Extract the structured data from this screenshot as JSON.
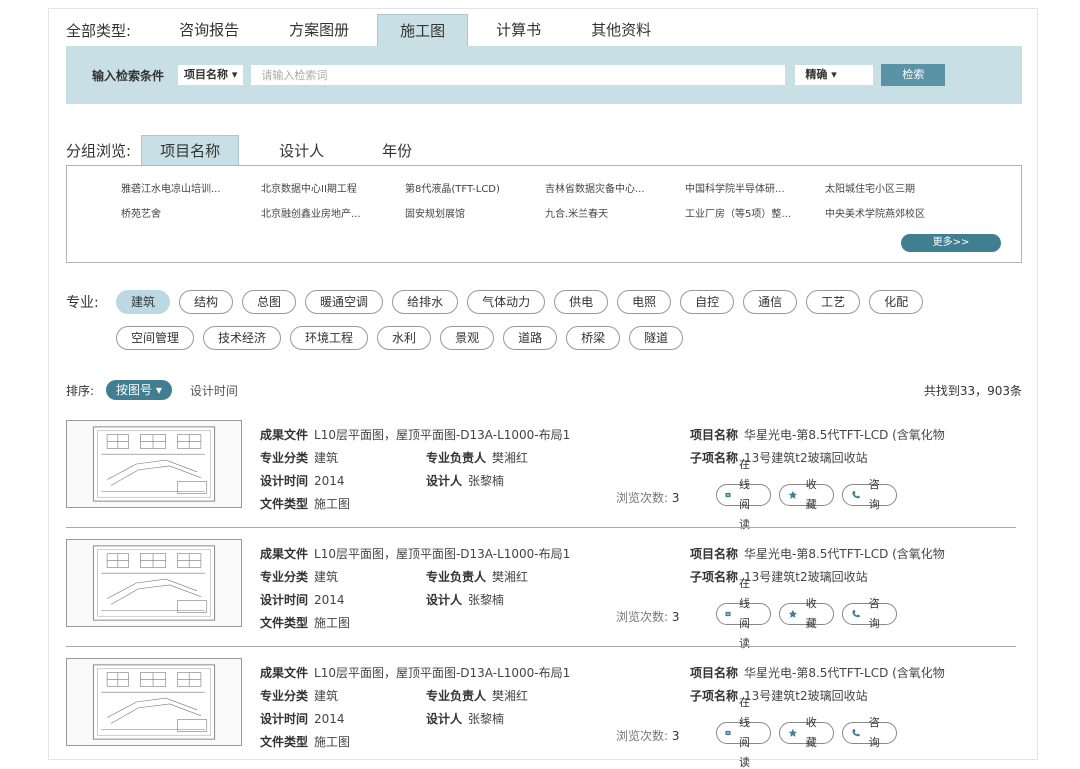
{
  "types": {
    "label": "全部类型:",
    "tabs": [
      "咨询报告",
      "方案图册",
      "施工图",
      "计算书",
      "其他资料"
    ],
    "active": 2
  },
  "search": {
    "label": "输入检索条件",
    "field": "项目名称 ▾",
    "placeholder": "请输入检索词",
    "mode": "精确 ▾",
    "button": "检索"
  },
  "group": {
    "label": "分组浏览:",
    "tabs": [
      "项目名称",
      "设计人",
      "年份"
    ],
    "items": [
      "雅砻江水电凉山培训...",
      "北京数据中心II期工程",
      "第8代液晶(TFT-LCD)",
      "吉林省数据灾备中心...",
      "中国科学院半导体研...",
      "太阳城住宅小区三期",
      "桥苑艺舍",
      "北京融创鑫业房地产...",
      "固安规划展馆",
      "九合.米兰春天",
      "工业厂房（等5项）整...",
      "中央美术学院燕郊校区"
    ],
    "more": "更多>>"
  },
  "specialty": {
    "label": "专业:",
    "row1": [
      "建筑",
      "结构",
      "总图",
      "暖通空调",
      "给排水",
      "气体动力",
      "供电",
      "电照",
      "自控",
      "通信",
      "工艺",
      "化配"
    ],
    "row2": [
      "空间管理",
      "技术经济",
      "环境工程",
      "水利",
      "景观",
      "道路",
      "桥梁",
      "隧道"
    ],
    "active": "建筑"
  },
  "sort": {
    "label": "排序:",
    "active": "按图号 ▾",
    "option": "设计时间",
    "total": "共找到33，903条"
  },
  "labels": {
    "result_file": "成果文件",
    "specialty": "专业分类",
    "leader": "专业负责人",
    "design_time": "设计时间",
    "designer": "设计人",
    "file_type": "文件类型",
    "project": "项目名称",
    "subitem": "子项名称",
    "views": "浏览次数:",
    "read": "在线阅读",
    "collect": "收藏",
    "consult": "咨询"
  },
  "results": [
    {
      "file": "L10层平面图，屋顶平面图-D13A-L1000-布局1",
      "specialty": "建筑",
      "leader": "樊湘红",
      "year": "2014",
      "designer": "张黎楠",
      "type": "施工图",
      "project": "华星光电-第8.5代TFT-LCD (含氧化物",
      "subitem": "13号建筑t2玻璃回收站",
      "views": "3"
    },
    {
      "file": "L10层平面图，屋顶平面图-D13A-L1000-布局1",
      "specialty": "建筑",
      "leader": "樊湘红",
      "year": "2014",
      "designer": "张黎楠",
      "type": "施工图",
      "project": "华星光电-第8.5代TFT-LCD (含氧化物",
      "subitem": "13号建筑t2玻璃回收站",
      "views": "3"
    },
    {
      "file": "L10层平面图，屋顶平面图-D13A-L1000-布局1",
      "specialty": "建筑",
      "leader": "樊湘红",
      "year": "2014",
      "designer": "张黎楠",
      "type": "施工图",
      "project": "华星光电-第8.5代TFT-LCD (含氧化物",
      "subitem": "13号建筑t2玻璃回收站",
      "views": "3"
    }
  ]
}
